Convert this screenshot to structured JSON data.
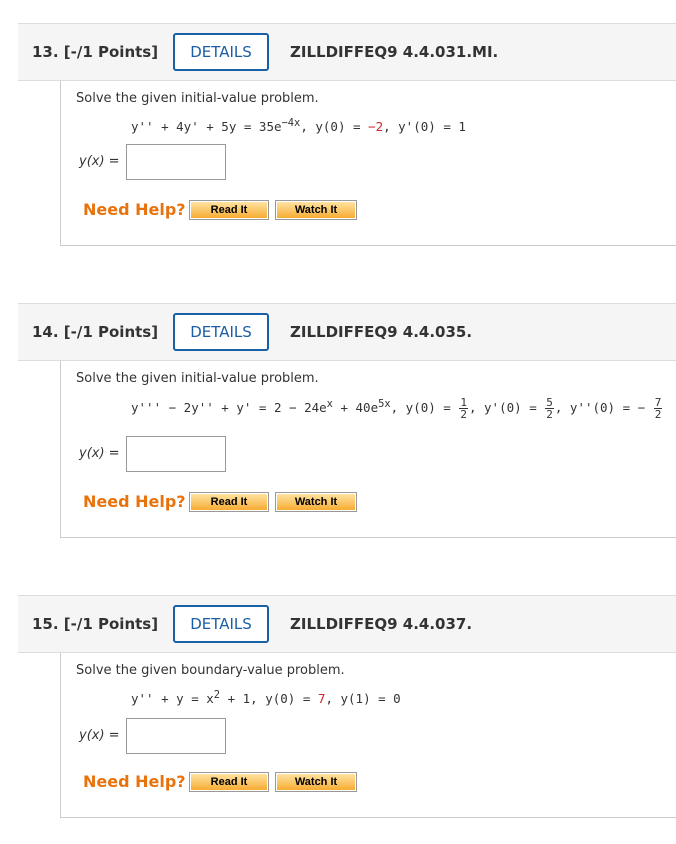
{
  "questions": [
    {
      "number": "13. [-/1 Points]",
      "details": "DETAILS",
      "code": "ZILLDIFFEQ9 4.4.031.MI.",
      "prompt": "Solve the given initial-value problem.",
      "answer_label": "y(x)",
      "answer_value": "",
      "need_help": "Need Help?",
      "read_it": "Read It",
      "watch_it": "Watch It"
    },
    {
      "number": "14. [-/1 Points]",
      "details": "DETAILS",
      "code": "ZILLDIFFEQ9 4.4.035.",
      "prompt": "Solve the given initial-value problem.",
      "answer_label": "y(x)",
      "answer_value": "",
      "need_help": "Need Help?",
      "read_it": "Read It",
      "watch_it": "Watch It"
    },
    {
      "number": "15. [-/1 Points]",
      "details": "DETAILS",
      "code": "ZILLDIFFEQ9 4.4.037.",
      "prompt": "Solve the given boundary-value problem.",
      "answer_label": "y(x)",
      "answer_value": "",
      "need_help": "Need Help?",
      "read_it": "Read It",
      "watch_it": "Watch It"
    }
  ],
  "eq13": {
    "lhs": "y'' + 4y' + 5y = 35e",
    "exp": "−4x",
    "ic1": ", y(0) = ",
    "ic1_val": "−2",
    "ic2": ", y'(0) = 1"
  },
  "eq14": {
    "lhs": "y''' − 2y'' + y' = 2 − 24e",
    "exp1": "x",
    "mid": " + 40e",
    "exp2": "5x",
    "ic1": ",   y(0) = ",
    "f1_num": "1",
    "f1_den": "2",
    "ic2": ", y'(0) = ",
    "f2_num": "5",
    "f2_den": "2",
    "ic3": ", y''(0) = − ",
    "f3_num": "7",
    "f3_den": "2"
  },
  "eq15": {
    "lhs": "y'' + y = x",
    "exp": "2",
    "rhs": " + 1,  y(0) = ",
    "bc1_val": "7",
    "bc2": ",  y(1) = 0"
  },
  "colors": {
    "accent": "#1a5ea6",
    "help": "#e8730c",
    "red": "#d0262a"
  }
}
